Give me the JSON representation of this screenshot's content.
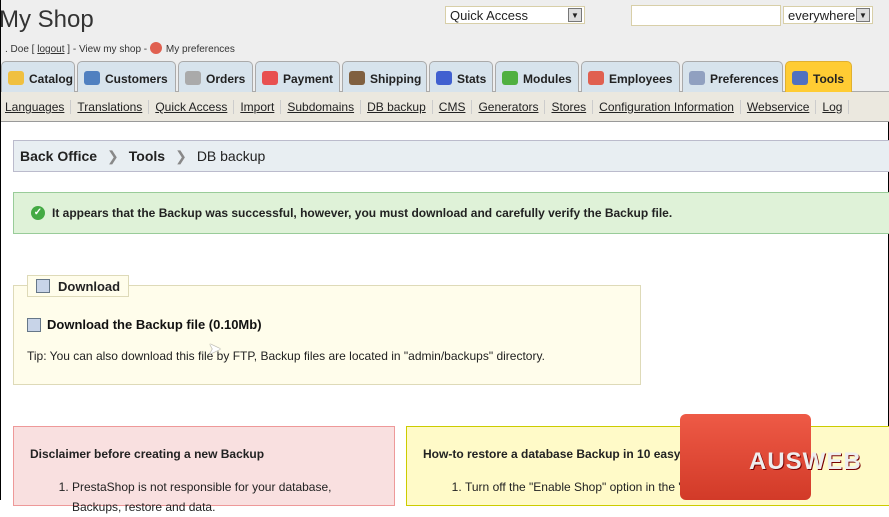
{
  "header": {
    "title": "My Shop",
    "user_prefix": ". Doe [ ",
    "logout": "logout",
    "user_mid": " ] - View my shop - ",
    "preferences": "My preferences",
    "quick_access": "Quick Access",
    "search_value": "",
    "search_scope": "everywhere"
  },
  "tabs": [
    {
      "label": "Catalog",
      "color": "#f0c040"
    },
    {
      "label": "Customers",
      "color": "#5080c0"
    },
    {
      "label": "Orders",
      "color": "#aaaaaa"
    },
    {
      "label": "Payment",
      "color": "#e85050"
    },
    {
      "label": "Shipping",
      "color": "#806040"
    },
    {
      "label": "Stats",
      "color": "#4060d0"
    },
    {
      "label": "Modules",
      "color": "#50b040"
    },
    {
      "label": "Employees",
      "color": "#e06050"
    },
    {
      "label": "Preferences",
      "color": "#90a0c0"
    },
    {
      "label": "Tools",
      "color": "#5070c0",
      "active": true
    }
  ],
  "subnav": [
    "Languages",
    "Translations",
    "Quick Access",
    "Import",
    "Subdomains",
    "DB backup",
    "CMS",
    "Generators",
    "Stores",
    "Configuration Information",
    "Webservice",
    "Log"
  ],
  "breadcrumb": {
    "items": [
      "Back Office",
      "Tools"
    ],
    "current": "DB backup"
  },
  "confirmation": "It appears that the Backup was successful, however, you must download and carefully verify the Backup file.",
  "download": {
    "legend": "Download",
    "link": "Download the Backup file (0.10Mb)",
    "tip": "Tip: You can also download this file by FTP, Backup files are located in \"admin/backups\" directory."
  },
  "disclaimer": {
    "title": "Disclaimer before creating a new Backup",
    "items": [
      "PrestaShop is not responsible for your database, Backups, restore and data."
    ]
  },
  "howto": {
    "title": "How-to restore a database Backup in 10 easy steps",
    "items": [
      "Turn off the \"Enable Shop\" option in the \"Preferences\" tab."
    ]
  },
  "watermark": "AUSWEB"
}
